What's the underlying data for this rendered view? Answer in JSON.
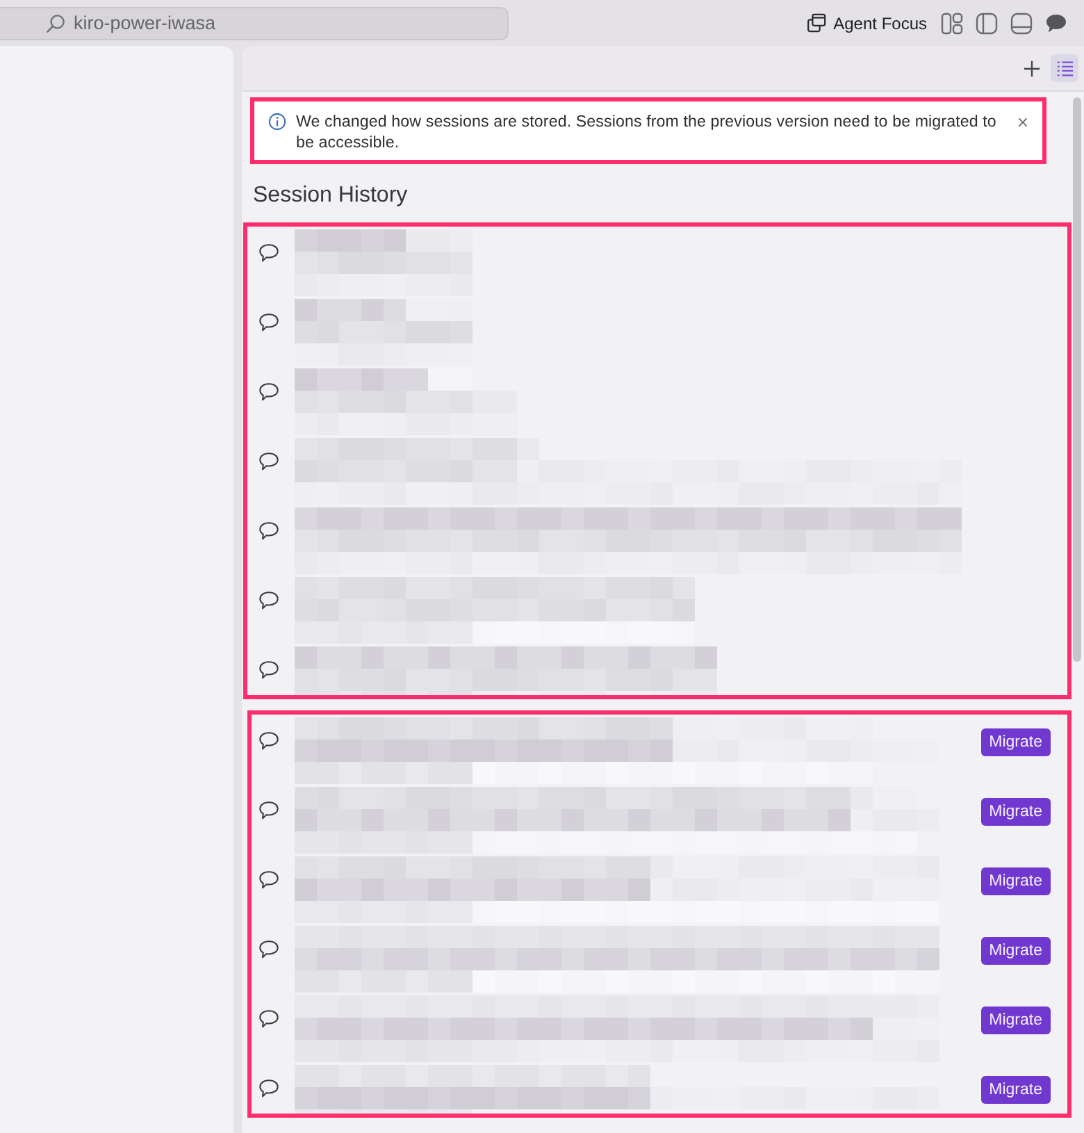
{
  "top_bar": {
    "command_center": {
      "label": "kiro-power-iwasa"
    },
    "agent_focus": {
      "label": "Agent Focus"
    }
  },
  "panel_toolbar": {
    "buttons": [
      {
        "kind": "add",
        "selected": false
      },
      {
        "kind": "list",
        "selected": true
      }
    ]
  },
  "notice": {
    "highlighted": true,
    "text": "We changed how sessions are stored. Sessions from the previous version need to be migrated to be accessible."
  },
  "session_history": {
    "title": "Session History",
    "groups": [
      {
        "highlighted": true,
        "sessions": [
          {
            "kind": "current"
          },
          {
            "kind": "current"
          },
          {
            "kind": "current"
          },
          {
            "kind": "current"
          },
          {
            "kind": "current"
          },
          {
            "kind": "current"
          },
          {
            "kind": "current"
          }
        ]
      },
      {
        "highlighted": true,
        "sessions": [
          {
            "kind": "legacy",
            "action": "Migrate"
          },
          {
            "kind": "legacy",
            "action": "Migrate"
          },
          {
            "kind": "legacy",
            "action": "Migrate"
          },
          {
            "kind": "legacy",
            "action": "Migrate"
          },
          {
            "kind": "legacy",
            "action": "Migrate"
          },
          {
            "kind": "legacy",
            "action": "Migrate"
          }
        ]
      }
    ]
  }
}
